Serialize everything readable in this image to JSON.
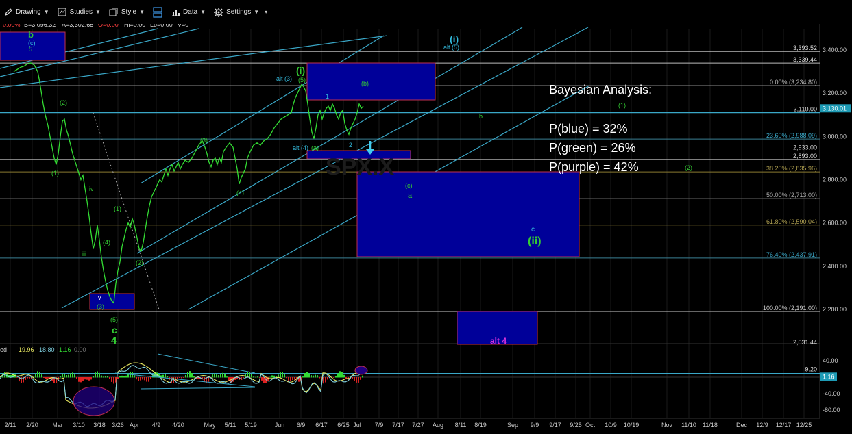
{
  "toolbar": {
    "items": [
      {
        "label": "Drawing",
        "icon": "pencil-icon"
      },
      {
        "label": "Studies",
        "icon": "studies-icon"
      },
      {
        "label": "Style",
        "icon": "style-icon"
      },
      {
        "label": "",
        "icon": "layout-icon"
      },
      {
        "label": "Data",
        "icon": "bar-chart-icon"
      },
      {
        "label": "Settings",
        "icon": "gear-icon"
      }
    ]
  },
  "quote_bar": {
    "change": "0.00%",
    "bid": "B=3,096.32",
    "ask": "A=3,302.65",
    "open": "O=0.00",
    "high": "Hi=0.00",
    "low": "Lo=0.00",
    "volume": "V=0"
  },
  "indicator_header": {
    "label": "ed",
    "v1": "19.96",
    "v2": "18.80",
    "v3": "1.16",
    "v4": "0.00"
  },
  "analysis": {
    "title": "Bayesian Analysis:",
    "lines": [
      "P(blue) = 32%",
      "P(green) =  26%",
      "P(purple) = 42%"
    ]
  },
  "colors": {
    "price": "#33dd33",
    "channel": "#3aa7c7",
    "box_fill": "#000099",
    "box_border": "#c03050",
    "blue_label": "#33bbdd",
    "green_label": "#33cc33",
    "magenta_label": "#dd33dd",
    "price_tag": "#1e9bb5"
  },
  "chart_data": [
    {
      "type": "line",
      "series_name": "",
      "y_ticks": [
        "3,400.00",
        "3,200.00",
        "3,000.00",
        "2,800.00",
        "2,600.00",
        "2,400.00",
        "2,200.00"
      ],
      "x_ticks": [
        "2/11",
        "2/20",
        "Mar",
        "3/10",
        "3/18",
        "3/26",
        "Apr",
        "4/9",
        "4/20",
        "May",
        "5/11",
        "5/19",
        "Jun",
        "6/9",
        "6/17",
        "6/25",
        "Jul",
        "7/9",
        "7/17",
        "7/27",
        "Aug",
        "8/11",
        "8/19",
        "Sep",
        "9/9",
        "9/17",
        "9/25",
        "Oct",
        "10/9",
        "10/19",
        "Nov",
        "11/10",
        "11/18",
        "Dec",
        "12/9",
        "12/17",
        "12/25"
      ],
      "ylim": [
        2030,
        3450
      ],
      "last_price": 3130.01,
      "last_price_label": "3,130.01",
      "price_path": [
        [
          20,
          3300
        ],
        [
          25,
          3310
        ],
        [
          30,
          3320
        ],
        [
          35,
          3325
        ],
        [
          40,
          3335
        ],
        [
          45,
          3340
        ],
        [
          50,
          3330
        ],
        [
          55,
          3300
        ],
        [
          58,
          3250
        ],
        [
          60,
          3210
        ],
        [
          63,
          3150
        ],
        [
          66,
          3100
        ],
        [
          70,
          3050
        ],
        [
          73,
          3000
        ],
        [
          76,
          2950
        ],
        [
          79,
          2900
        ],
        [
          82,
          2870
        ],
        [
          85,
          2920
        ],
        [
          88,
          3000
        ],
        [
          91,
          3070
        ],
        [
          94,
          3080
        ],
        [
          97,
          3030
        ],
        [
          100,
          3000
        ],
        [
          103,
          2960
        ],
        [
          106,
          2920
        ],
        [
          109,
          2890
        ],
        [
          112,
          2860
        ],
        [
          115,
          2830
        ],
        [
          118,
          2800
        ],
        [
          121,
          2820
        ],
        [
          124,
          2760
        ],
        [
          127,
          2700
        ],
        [
          130,
          2630
        ],
        [
          133,
          2550
        ],
        [
          136,
          2480
        ],
        [
          139,
          2520
        ],
        [
          142,
          2590
        ],
        [
          145,
          2520
        ],
        [
          148,
          2440
        ],
        [
          151,
          2380
        ],
        [
          154,
          2330
        ],
        [
          157,
          2290
        ],
        [
          160,
          2260
        ],
        [
          163,
          2240
        ],
        [
          166,
          2230
        ],
        [
          169,
          2320
        ],
        [
          172,
          2380
        ],
        [
          175,
          2420
        ],
        [
          178,
          2490
        ],
        [
          181,
          2530
        ],
        [
          184,
          2570
        ],
        [
          187,
          2600
        ],
        [
          190,
          2580
        ],
        [
          193,
          2620
        ],
        [
          196,
          2590
        ],
        [
          200,
          2530
        ],
        [
          203,
          2480
        ],
        [
          206,
          2470
        ],
        [
          209,
          2510
        ],
        [
          212,
          2570
        ],
        [
          215,
          2630
        ],
        [
          218,
          2680
        ],
        [
          221,
          2720
        ],
        [
          224,
          2740
        ],
        [
          227,
          2760
        ],
        [
          230,
          2780
        ],
        [
          233,
          2800
        ],
        [
          236,
          2790
        ],
        [
          239,
          2820
        ],
        [
          242,
          2850
        ],
        [
          245,
          2820
        ],
        [
          248,
          2850
        ],
        [
          251,
          2870
        ],
        [
          254,
          2840
        ],
        [
          257,
          2860
        ],
        [
          260,
          2880
        ],
        [
          263,
          2850
        ],
        [
          266,
          2870
        ],
        [
          270,
          2890
        ],
        [
          275,
          2880
        ],
        [
          280,
          2900
        ],
        [
          285,
          2930
        ],
        [
          290,
          2960
        ],
        [
          295,
          2980
        ],
        [
          299,
          2950
        ],
        [
          302,
          2920
        ],
        [
          305,
          2880
        ],
        [
          308,
          2860
        ],
        [
          311,
          2890
        ],
        [
          314,
          2900
        ],
        [
          317,
          2870
        ],
        [
          320,
          2900
        ],
        [
          323,
          2880
        ],
        [
          326,
          2930
        ],
        [
          330,
          2950
        ],
        [
          335,
          2970
        ],
        [
          340,
          2950
        ],
        [
          343,
          2900
        ],
        [
          346,
          2850
        ],
        [
          349,
          2780
        ],
        [
          352,
          2810
        ],
        [
          355,
          2830
        ],
        [
          358,
          2850
        ],
        [
          361,
          2900
        ],
        [
          365,
          2930
        ],
        [
          370,
          2960
        ],
        [
          375,
          2970
        ],
        [
          380,
          2960
        ],
        [
          385,
          2980
        ],
        [
          390,
          2990
        ],
        [
          395,
          3010
        ],
        [
          400,
          3040
        ],
        [
          405,
          3060
        ],
        [
          410,
          3080
        ],
        [
          415,
          3090
        ],
        [
          420,
          3100
        ],
        [
          425,
          3110
        ],
        [
          428,
          3150
        ],
        [
          431,
          3180
        ],
        [
          434,
          3200
        ],
        [
          437,
          3220
        ],
        [
          440,
          3240
        ],
        [
          443,
          3230
        ],
        [
          446,
          3210
        ],
        [
          449,
          3150
        ],
        [
          452,
          3080
        ],
        [
          455,
          3020
        ],
        [
          458,
          2990
        ],
        [
          461,
          3040
        ],
        [
          464,
          3100
        ],
        [
          467,
          3120
        ],
        [
          470,
          3080
        ],
        [
          473,
          3110
        ],
        [
          476,
          3130
        ],
        [
          479,
          3140
        ],
        [
          482,
          3120
        ],
        [
          485,
          3150
        ],
        [
          488,
          3130
        ],
        [
          491,
          3100
        ],
        [
          494,
          3080
        ],
        [
          497,
          3110
        ],
        [
          500,
          3120
        ],
        [
          503,
          3060
        ],
        [
          506,
          3030
        ],
        [
          509,
          3010
        ],
        [
          512,
          3040
        ],
        [
          515,
          3060
        ],
        [
          518,
          3080
        ],
        [
          521,
          3110
        ],
        [
          524,
          3150
        ],
        [
          527,
          3130
        ],
        [
          530,
          3140
        ]
      ],
      "levels": [
        {
          "label": "3,393.52",
          "value": 3393.52
        },
        {
          "label": "3,339.44",
          "value": 3339.44
        },
        {
          "label": "0.00% (3,234.80)",
          "value": 3234.8
        },
        {
          "label": "3,110.00",
          "value": 3110.0
        },
        {
          "label": "23.60% (2,988.09)",
          "value": 2988.09
        },
        {
          "label": "2,933.00",
          "value": 2933.0
        },
        {
          "label": "2,893.00",
          "value": 2893.0
        },
        {
          "label": "38.20% (2,835.96)",
          "value": 2835.96
        },
        {
          "label": "50.00% (2,713.00)",
          "value": 2713.0
        },
        {
          "label": "61.80% (2,590.04)",
          "value": 2590.04
        },
        {
          "label": "76.40% (2,437.91)",
          "value": 2437.91
        },
        {
          "label": "100.00% (2,191.00)",
          "value": 2191.0
        },
        {
          "label": "2,031.44",
          "value": 2031.44
        }
      ],
      "wave_labels": [
        {
          "text": "b",
          "color": "green",
          "bold": true
        },
        {
          "text": "(c)",
          "color": "blue"
        },
        {
          "text": "5",
          "color": "green"
        },
        {
          "text": "(2)",
          "color": "green"
        },
        {
          "text": "(1)",
          "color": "green"
        },
        {
          "text": "iv",
          "color": "green"
        },
        {
          "text": "iii",
          "color": "green"
        },
        {
          "text": "(4)",
          "color": "green"
        },
        {
          "text": "(1)",
          "color": "green"
        },
        {
          "text": "(2)",
          "color": "green"
        },
        {
          "text": "v",
          "color": "white"
        },
        {
          "text": "(3)",
          "color": "green"
        },
        {
          "text": "(5)",
          "color": "green"
        },
        {
          "text": "c",
          "color": "green",
          "bold": true
        },
        {
          "text": "4",
          "color": "green",
          "bold": true
        },
        {
          "text": "(3)",
          "color": "green"
        },
        {
          "text": "(4)",
          "color": "green"
        },
        {
          "text": "alt (3)",
          "color": "blue"
        },
        {
          "text": "(i)",
          "color": "green",
          "bold": true
        },
        {
          "text": "(5)",
          "color": "green"
        },
        {
          "text": "1",
          "color": "blue"
        },
        {
          "text": "(b)",
          "color": "green"
        },
        {
          "text": "alt (4)",
          "color": "blue"
        },
        {
          "text": "(a)",
          "color": "green"
        },
        {
          "text": "2",
          "color": "blue"
        },
        {
          "text": "(i)",
          "color": "blue",
          "bold": true
        },
        {
          "text": "alt (5)",
          "color": "blue"
        },
        {
          "text": "(1)",
          "color": "green"
        },
        {
          "text": "b",
          "color": "green"
        },
        {
          "text": "(2)",
          "color": "green"
        },
        {
          "text": "(c)",
          "color": "green"
        },
        {
          "text": "a",
          "color": "green"
        },
        {
          "text": "c",
          "color": "blue"
        },
        {
          "text": "(ii)",
          "color": "green",
          "bold": true
        },
        {
          "text": "alt 4",
          "color": "magenta",
          "bold": true
        }
      ]
    },
    {
      "type": "line",
      "y_ticks": [
        "40.00",
        "-40.00",
        "-80.00"
      ],
      "ylim": [
        -95,
        58
      ],
      "reference_level": 9.2,
      "reference_label": "9.20",
      "last_value": 1.16,
      "last_value_label": "1.16"
    }
  ]
}
